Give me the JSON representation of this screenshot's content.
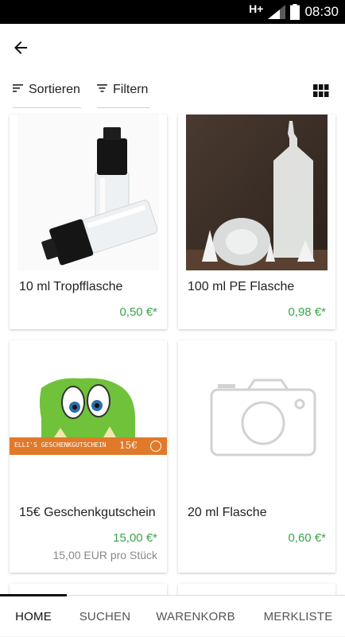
{
  "status": {
    "network": "H+",
    "time": "08:30"
  },
  "toolbar": {
    "sort_label": "Sortieren",
    "filter_label": "Filtern"
  },
  "products": [
    {
      "name": "10 ml Tropfflasche",
      "price": "0,50 €*"
    },
    {
      "name": "100 ml PE Flasche",
      "price": "0,98 €*"
    },
    {
      "name": "15€ Geschenkgutschein",
      "price": "15,00 €*",
      "unit_price": "15,00 EUR pro Stück",
      "voucher_banner": "ELLI'S GESCHENKGUTSCHEIN",
      "voucher_value": "15€"
    },
    {
      "name": "20 ml Flasche",
      "price": "0,60 €*"
    }
  ],
  "bottom_nav": [
    {
      "label": "HOME"
    },
    {
      "label": "SUCHEN"
    },
    {
      "label": "WARENKORB"
    },
    {
      "label": "MERKLISTE"
    }
  ],
  "colors": {
    "price_green": "#3ba54a",
    "voucher_orange": "#e07a2a",
    "monster_green": "#6fc23a"
  },
  "icons": {
    "back": "arrow-left-icon",
    "sort": "sort-icon",
    "filter": "filter-icon",
    "grid": "grid-view-icon",
    "placeholder": "camera-icon"
  }
}
